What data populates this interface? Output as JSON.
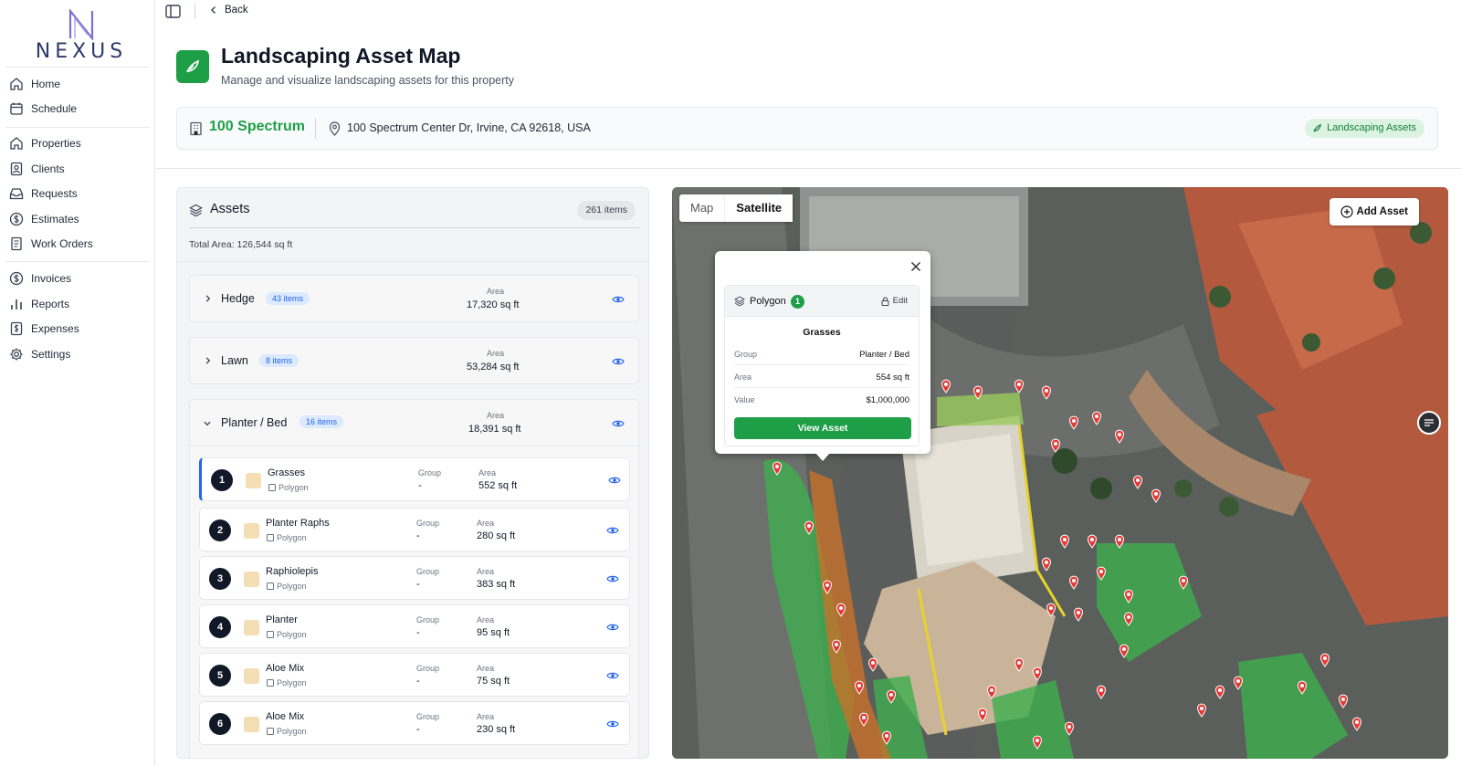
{
  "app": {
    "logo_text": "NEXUS"
  },
  "nav": {
    "group1": [
      {
        "label": "Home",
        "icon": "home-icon"
      },
      {
        "label": "Schedule",
        "icon": "calendar-icon"
      }
    ],
    "group2": [
      {
        "label": "Properties",
        "icon": "home-icon"
      },
      {
        "label": "Clients",
        "icon": "contact-icon"
      },
      {
        "label": "Requests",
        "icon": "inbox-icon"
      },
      {
        "label": "Estimates",
        "icon": "dollar-icon"
      },
      {
        "label": "Work Orders",
        "icon": "document-icon"
      }
    ],
    "group3": [
      {
        "label": "Invoices",
        "icon": "dollar-icon"
      },
      {
        "label": "Reports",
        "icon": "bar-chart-icon"
      },
      {
        "label": "Expenses",
        "icon": "receipt-icon"
      },
      {
        "label": "Settings",
        "icon": "gear-icon"
      }
    ]
  },
  "topbar": {
    "back_label": "Back"
  },
  "header": {
    "title": "Landscaping Asset Map",
    "subtitle": "Manage and visualize landscaping assets for this property"
  },
  "property": {
    "name": "100 Spectrum",
    "address": "100 Spectrum Center Dr, Irvine, CA 92618, USA",
    "tag": "Landscaping Assets"
  },
  "assets": {
    "title": "Assets",
    "count_badge": "261 items",
    "total_area": "Total Area: 126,544 sq ft",
    "area_label": "Area",
    "group_label": "Group",
    "groups": [
      {
        "name": "Hedge",
        "badge": "43 items",
        "area": "17,320 sq ft"
      },
      {
        "name": "Lawn",
        "badge": "8 items",
        "area": "53,284 sq ft"
      },
      {
        "name": "Planter / Bed",
        "badge": "16 items",
        "area": "18,391 sq ft"
      }
    ],
    "items": [
      {
        "num": "1",
        "name": "Grasses",
        "type": "Polygon",
        "group": "-",
        "area": "552 sq ft"
      },
      {
        "num": "2",
        "name": "Planter Raphs",
        "type": "Polygon",
        "group": "-",
        "area": "280 sq ft"
      },
      {
        "num": "3",
        "name": "Raphiolepis",
        "type": "Polygon",
        "group": "-",
        "area": "383 sq ft"
      },
      {
        "num": "4",
        "name": "Planter",
        "type": "Polygon",
        "group": "-",
        "area": "95 sq ft"
      },
      {
        "num": "5",
        "name": "Aloe Mix",
        "type": "Polygon",
        "group": "-",
        "area": "75 sq ft"
      },
      {
        "num": "6",
        "name": "Aloe Mix",
        "type": "Polygon",
        "group": "-",
        "area": "230 sq ft"
      }
    ]
  },
  "map": {
    "tab_map": "Map",
    "tab_satellite": "Satellite",
    "selected_tab": "Satellite",
    "add_asset_label": "Add Asset",
    "popup": {
      "type": "Polygon",
      "count": "1",
      "edit_label": "Edit",
      "name": "Grasses",
      "group_label": "Group",
      "group_value": "Planter / Bed",
      "area_label": "Area",
      "area_value": "554 sq ft",
      "value_label": "Value",
      "value_value": "$1,000,000",
      "button_label": "View Asset"
    }
  },
  "colors": {
    "accent_green": "#1e9e47",
    "badge_blue": "#dbeafe",
    "marker_red": "#e53935",
    "selected_border": "#2563eb"
  }
}
